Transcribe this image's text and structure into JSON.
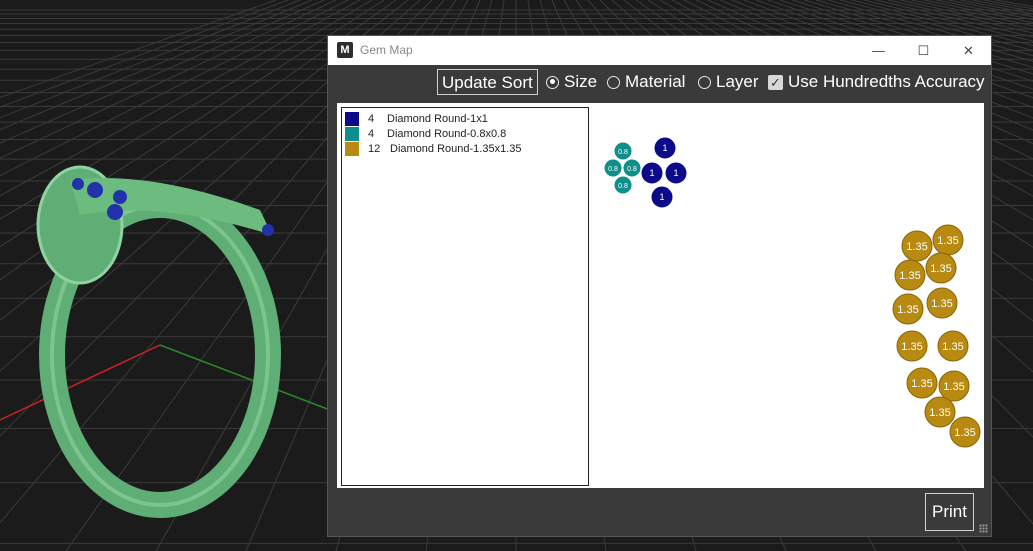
{
  "window": {
    "title": "Gem Map",
    "app_icon": "M",
    "minimize_glyph": "—",
    "maximize_glyph": "☐",
    "close_glyph": "✕"
  },
  "toolbar": {
    "update_sort_label": "Update Sort",
    "options": [
      {
        "label": "Size",
        "checked": true
      },
      {
        "label": "Material",
        "checked": false
      },
      {
        "label": "Layer",
        "checked": false
      }
    ],
    "hundredths": {
      "label": "Use Hundredths Accuracy",
      "checked": true
    }
  },
  "legend": [
    {
      "count": "4",
      "name": "Diamond Round-1x1",
      "color": "#0b0b8a"
    },
    {
      "count": "4",
      "name": "Diamond Round-0.8x0.8",
      "color": "#0f8f8c"
    },
    {
      "count": "12",
      "name": "Diamond Round-1.35x1.35",
      "color": "#b88a12"
    }
  ],
  "gem_labels": {
    "large": "1",
    "small": "0.8",
    "gold": "1.35"
  },
  "print_label": "Print"
}
